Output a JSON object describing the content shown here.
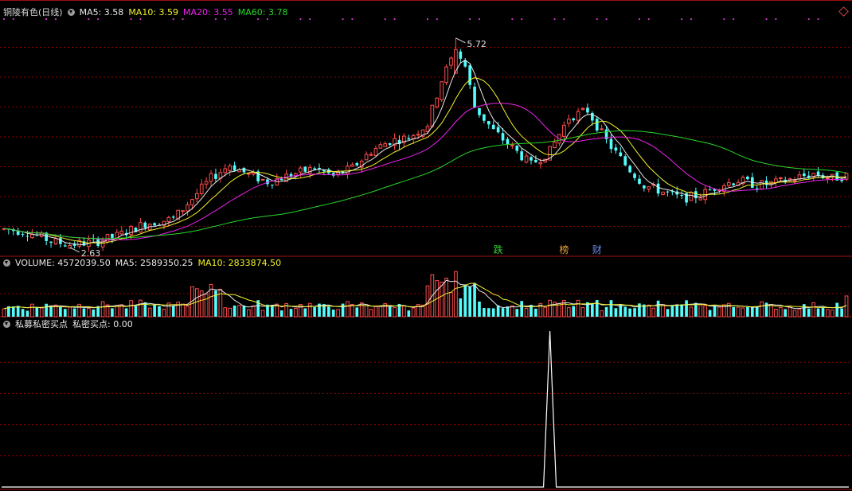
{
  "header": {
    "stock_name": "铜陵有色(日线)",
    "ma5": "MA5: 3.58",
    "ma10": "MA10: 3.59",
    "ma20": "MA20: 3.55",
    "ma60": "MA60: 3.78"
  },
  "volume_header": {
    "volume": "VOLUME: 4572039.50",
    "ma5": "MA5: 2589350.25",
    "ma10": "MA10: 2833874.50"
  },
  "indicator_header": {
    "name": "私募私密买点",
    "value": "私密买点: 0.00"
  },
  "markers": [
    {
      "text": "跌",
      "color": "#32d232",
      "index": 105
    },
    {
      "text": "榜",
      "color": "#e8a33a",
      "index": 119
    },
    {
      "text": "财",
      "color": "#6a8de8",
      "index": 126
    }
  ],
  "colors": {
    "up": "#ff4d4d",
    "down": "#54fcfc",
    "ma5": "#e8e8e8",
    "ma10": "#f2f22a",
    "ma20": "#ee22ee",
    "ma60": "#28d728",
    "grid": "#8b0000",
    "indicator": "#ffffff"
  },
  "chart_data": [
    {
      "type": "candlestick",
      "title": "铜陵有色(日线)",
      "ylim": [
        2.5,
        6.0
      ],
      "y_high_label": "5.72",
      "y_low_label": "2.63",
      "ohlc_knots": [
        [
          0,
          2.9
        ],
        [
          5,
          2.86
        ],
        [
          10,
          2.72
        ],
        [
          14,
          2.67
        ],
        [
          20,
          2.72
        ],
        [
          24,
          2.8
        ],
        [
          30,
          2.98
        ],
        [
          36,
          3.05
        ],
        [
          40,
          3.35
        ],
        [
          44,
          3.65
        ],
        [
          48,
          3.85
        ],
        [
          52,
          3.7
        ],
        [
          56,
          3.6
        ],
        [
          62,
          3.72
        ],
        [
          66,
          3.8
        ],
        [
          70,
          3.68
        ],
        [
          74,
          3.8
        ],
        [
          78,
          4.05
        ],
        [
          82,
          4.2
        ],
        [
          86,
          4.25
        ],
        [
          90,
          4.45
        ],
        [
          93,
          5.1
        ],
        [
          96,
          5.55
        ],
        [
          98,
          5.3
        ],
        [
          100,
          4.7
        ],
        [
          104,
          4.35
        ],
        [
          108,
          4.1
        ],
        [
          112,
          3.85
        ],
        [
          116,
          4.05
        ],
        [
          120,
          4.55
        ],
        [
          124,
          4.65
        ],
        [
          128,
          4.2
        ],
        [
          132,
          3.85
        ],
        [
          136,
          3.55
        ],
        [
          140,
          3.45
        ],
        [
          144,
          3.35
        ],
        [
          148,
          3.4
        ],
        [
          152,
          3.55
        ],
        [
          156,
          3.62
        ],
        [
          160,
          3.55
        ],
        [
          164,
          3.58
        ],
        [
          168,
          3.65
        ],
        [
          172,
          3.72
        ],
        [
          176,
          3.65
        ],
        [
          180,
          3.7
        ]
      ],
      "ma5": "MA5: 3.58",
      "ma10": "MA10: 3.59",
      "ma20": "MA20: 3.55",
      "ma60": "MA60: 3.78",
      "candle_count": 180
    },
    {
      "type": "bar",
      "title": "VOLUME",
      "volume_last": 4572039.5,
      "ma5_last": 2589350.25,
      "ma10_last": 2833874.5,
      "spike_indices": [
        40,
        44,
        93,
        96
      ],
      "ylim": [
        0,
        10000000
      ]
    },
    {
      "type": "line",
      "title": "私募私密买点",
      "spike_index": 116,
      "spike_value": 1,
      "last_value": 0.0,
      "ylim": [
        0,
        1
      ]
    }
  ]
}
